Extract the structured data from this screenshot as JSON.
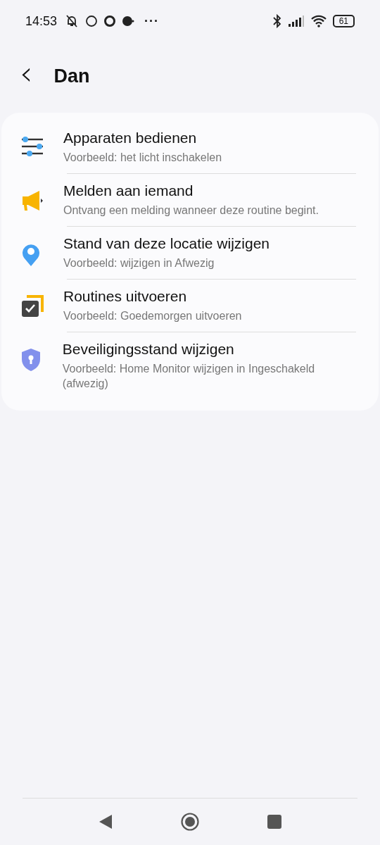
{
  "status_bar": {
    "time": "14:53",
    "more": "···",
    "battery": "61"
  },
  "header": {
    "back": "‹",
    "title": "Dan"
  },
  "items": [
    {
      "kind": "sliders",
      "title": "Apparaten bedienen",
      "subtitle": "Voorbeeld: het licht inschakelen"
    },
    {
      "kind": "megaphone",
      "title": "Melden aan iemand",
      "subtitle": "Ontvang een melding wanneer deze routine begint."
    },
    {
      "kind": "pin",
      "title": "Stand van deze locatie wijzigen",
      "subtitle": "Voorbeeld: wijzigen in Afwezig"
    },
    {
      "kind": "routines",
      "title": "Routines uitvoeren",
      "subtitle": "Voorbeeld: Goedemorgen uitvoeren"
    },
    {
      "kind": "shield",
      "title": "Beveiligingsstand wijzigen",
      "subtitle": "Voorbeeld: Home Monitor wijzigen in Ingeschakeld (afwezig)"
    }
  ]
}
